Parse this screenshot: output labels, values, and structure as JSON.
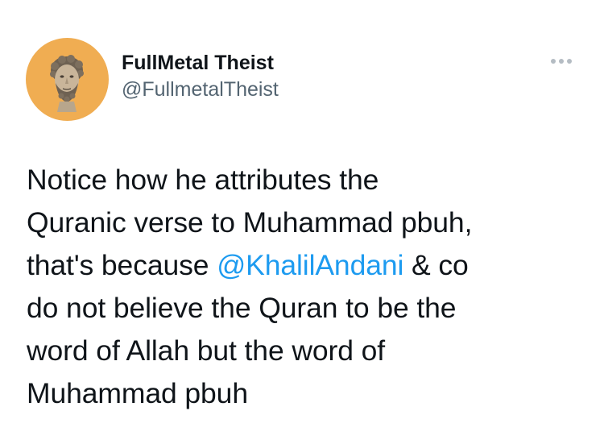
{
  "author": {
    "display_name": "FullMetal Theist",
    "handle": "@FullmetalTheist",
    "avatar_bg": "#f0ad52",
    "avatar_icon": "marble-bust-avatar"
  },
  "menu": {
    "icon": "more-horizontal-icon"
  },
  "tweet": {
    "line1": "Notice how he attributes the",
    "line2": "Quranic verse to Muhammad pbuh,",
    "line3_before": "that's because ",
    "mention": "@KhalilAndani",
    "line3_after": " & co",
    "line4": "do not believe the Quran to be the",
    "line5": "word of Allah but the word of",
    "line6": "Muhammad pbuh"
  },
  "colors": {
    "link": "#1d9bf0",
    "text": "#0f1419",
    "secondary": "#536471"
  }
}
